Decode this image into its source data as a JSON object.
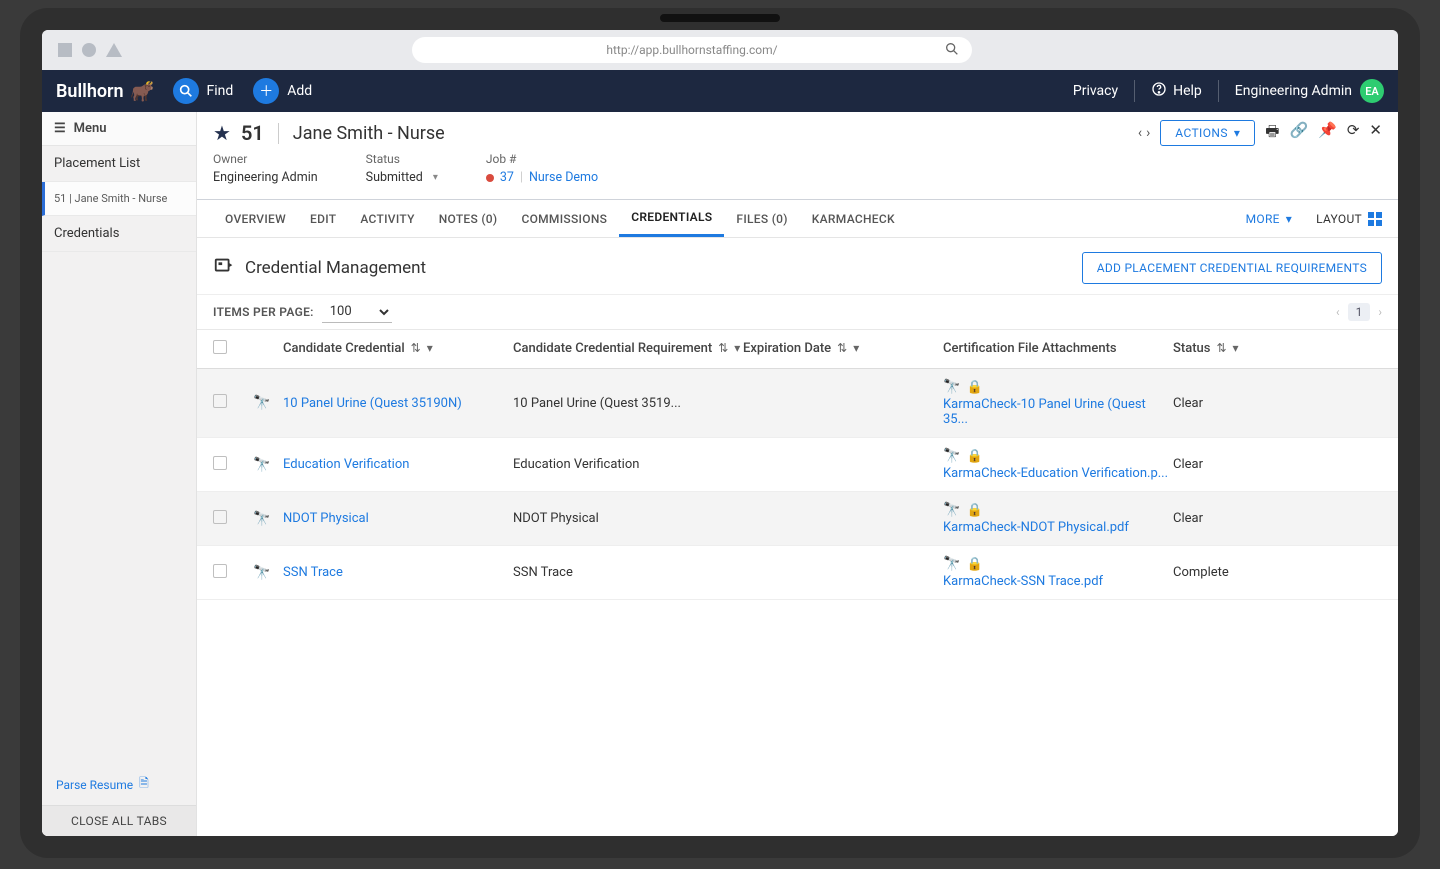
{
  "browser": {
    "url": "http://app.bullhornstaffing.com/"
  },
  "header": {
    "brand": "Bullhorn",
    "find": "Find",
    "add": "Add",
    "privacy": "Privacy",
    "help": "Help",
    "user": "Engineering Admin",
    "avatar": "EA"
  },
  "sidebar": {
    "menu": "Menu",
    "items": [
      "Placement List",
      "51 | Jane Smith - Nurse",
      "Credentials"
    ],
    "parse": "Parse Resume",
    "close": "CLOSE ALL TABS"
  },
  "record": {
    "id": "51",
    "name": "Jane Smith - Nurse",
    "actions": "ACTIONS",
    "meta": {
      "owner_label": "Owner",
      "owner": "Engineering Admin",
      "status_label": "Status",
      "status": "Submitted",
      "job_label": "Job #",
      "job_id": "37",
      "job_name": "Nurse Demo"
    }
  },
  "tabs": {
    "items": [
      "OVERVIEW",
      "EDIT",
      "ACTIVITY",
      "NOTES (0)",
      "COMMISSIONS",
      "CREDENTIALS",
      "FILES (0)",
      "KARMACHECK"
    ],
    "more": "MORE",
    "layout": "LAYOUT"
  },
  "section": {
    "title": "Credential Management",
    "add_button": "ADD PLACEMENT CREDENTIAL REQUIREMENTS"
  },
  "paging": {
    "ipp_label": "ITEMS PER PAGE:",
    "ipp_value": "100",
    "page": "1"
  },
  "columns": {
    "c1": "Candidate Credential",
    "c2": "Candidate Credential Requirement",
    "c3": "Expiration Date",
    "c4": "Certification File Attachments",
    "c5": "Status"
  },
  "rows": [
    {
      "cred": "10 Panel Urine (Quest 35190N)",
      "req": "10 Panel Urine (Quest 3519...",
      "exp": "",
      "attach": "KarmaCheck-10 Panel Urine (Quest 35...",
      "status": "Clear"
    },
    {
      "cred": "Education Verification",
      "req": "Education Verification",
      "exp": "",
      "attach": "KarmaCheck-Education Verification.p...",
      "status": "Clear"
    },
    {
      "cred": "NDOT Physical",
      "req": "NDOT Physical",
      "exp": "",
      "attach": "KarmaCheck-NDOT Physical.pdf",
      "status": "Clear"
    },
    {
      "cred": "SSN Trace",
      "req": "SSN Trace",
      "exp": "",
      "attach": "KarmaCheck-SSN Trace.pdf",
      "status": "Complete"
    }
  ]
}
